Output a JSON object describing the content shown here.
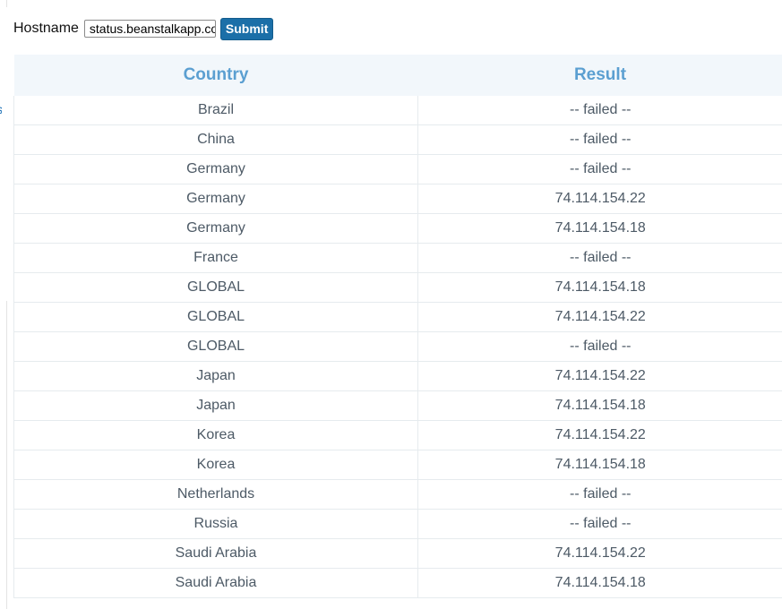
{
  "form": {
    "hostname_label": "Hostname",
    "hostname_value": "status.beanstalkapp.com",
    "submit_label": "Submit"
  },
  "table": {
    "headers": {
      "country": "Country",
      "result": "Result"
    },
    "rows": [
      {
        "country": "Brazil",
        "result": "-- failed --"
      },
      {
        "country": "China",
        "result": "-- failed --"
      },
      {
        "country": "Germany",
        "result": "-- failed --"
      },
      {
        "country": "Germany",
        "result": "74.114.154.22"
      },
      {
        "country": "Germany",
        "result": "74.114.154.18"
      },
      {
        "country": "France",
        "result": "-- failed --"
      },
      {
        "country": "GLOBAL",
        "result": "74.114.154.18"
      },
      {
        "country": "GLOBAL",
        "result": "74.114.154.22"
      },
      {
        "country": "GLOBAL",
        "result": "-- failed --"
      },
      {
        "country": "Japan",
        "result": "74.114.154.22"
      },
      {
        "country": "Japan",
        "result": "74.114.154.18"
      },
      {
        "country": "Korea",
        "result": "74.114.154.22"
      },
      {
        "country": "Korea",
        "result": "74.114.154.18"
      },
      {
        "country": "Netherlands",
        "result": "-- failed --"
      },
      {
        "country": "Russia",
        "result": "-- failed --"
      },
      {
        "country": "Saudi Arabia",
        "result": "74.114.154.22"
      },
      {
        "country": "Saudi Arabia",
        "result": "74.114.154.18"
      }
    ]
  },
  "colors": {
    "header_text": "#5b9fd1",
    "header_bg": "#f2f7fb",
    "button_bg": "#1b6fa8",
    "cell_text": "#4d5a66"
  }
}
